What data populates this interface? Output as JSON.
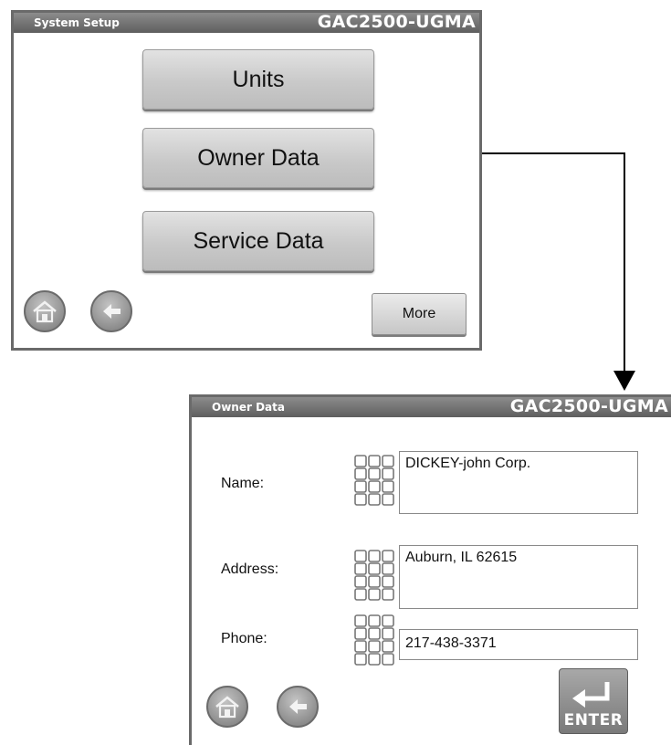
{
  "system_setup": {
    "title": "System Setup",
    "model": "GAC2500-UGMA",
    "buttons": {
      "units": "Units",
      "owner_data": "Owner Data",
      "service_data": "Service Data",
      "more": "More"
    },
    "icons": [
      "home-icon",
      "back-arrow-icon"
    ]
  },
  "owner_data": {
    "title": "Owner Data",
    "model": "GAC2500-UGMA",
    "fields": {
      "name_label": "Name:",
      "name_value": "DICKEY-john Corp.",
      "address_label": "Address:",
      "address_value": "Auburn, IL 62615",
      "phone_label": "Phone:",
      "phone_value": "217-438-3371"
    },
    "enter_label": "ENTER",
    "icons": [
      "home-icon",
      "back-arrow-icon",
      "keypad-icon",
      "enter-icon"
    ]
  },
  "colors": {
    "titlebar": "#6f6f6f",
    "panel_border": "#6a6a6a",
    "button_face": "#c9c9c9",
    "connector": "#000000"
  }
}
